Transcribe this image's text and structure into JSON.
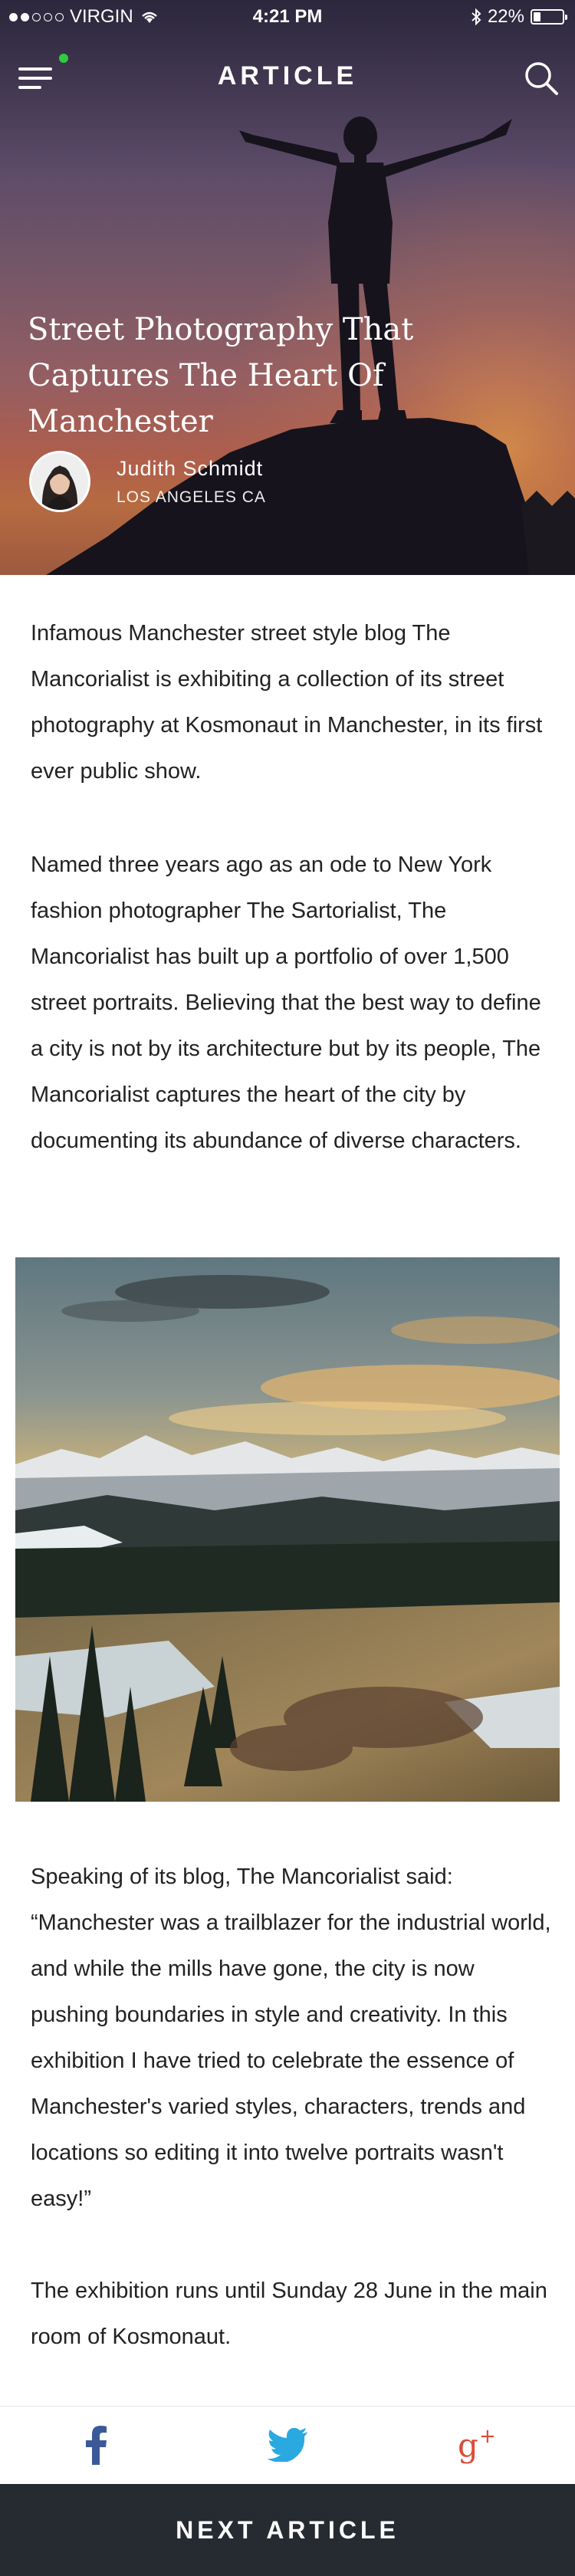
{
  "status_bar": {
    "carrier": "VIRGIN",
    "time": "4:21 PM",
    "battery": "22%",
    "battery_level": 0.22,
    "signal_bars_filled": 2,
    "signal_bars_total": 5
  },
  "nav": {
    "title": "ARTICLE",
    "menu_icon": "hamburger-menu-icon",
    "search_icon": "search-icon",
    "notification_color": "#2ecc40"
  },
  "hero": {
    "title": "Street Photography That Captures The Heart Of Manchester",
    "author_name": "Judith Schmidt",
    "author_location": "LOS ANGELES CA"
  },
  "article": {
    "paragraphs": [
      "Infamous Manchester street style blog The Mancorialist is exhibiting a collection of its street photography at Kosmonaut in Manchester, in its first ever public show.",
      "Named three years ago as an ode to New York fashion photographer The Sartorialist, The Mancorialist has built up a portfolio of over 1,500 street portraits. Believing that the best way to define a city is not by its architecture but by its people, The Mancorialist captures the heart of the city by documenting its abundance of diverse characters.",
      "Speaking of its blog, The Mancorialist said: “Manchester was a trailblazer for the industrial world, and while the mills have gone, the city is now pushing boundaries in style and creativity. In this exhibition I have tried to celebrate the essence of Manchester's varied styles, characters, trends and locations so editing it into twelve portraits wasn't easy!”",
      "The exhibition runs until Sunday 28 June in the main room of Kosmonaut."
    ]
  },
  "share": {
    "facebook_icon": "facebook-icon",
    "twitter_icon": "twitter-icon",
    "googleplus_icon": "google-plus-icon",
    "facebook_color": "#3b5998",
    "twitter_color": "#2aa9e0",
    "googleplus_color": "#dd4b39"
  },
  "footer": {
    "next_label": "NEXT ARTICLE"
  }
}
